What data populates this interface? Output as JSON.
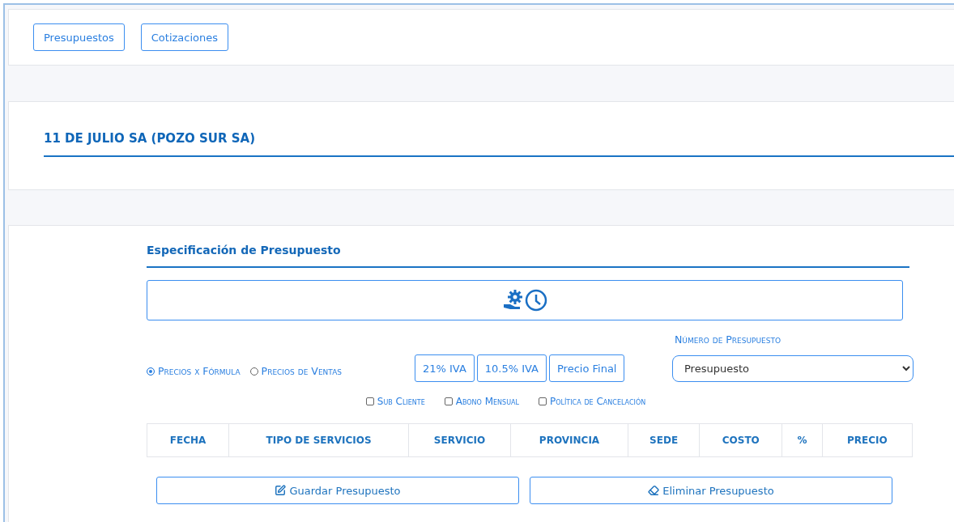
{
  "nav_buttons": [
    {
      "label": "Presupuestos"
    },
    {
      "label": "Cotizaciones"
    }
  ],
  "client_title": "11 DE JULIO SA (POZO SUR SA)",
  "section_title": "Especificación de Presupuesto",
  "price_modes": [
    {
      "label": "Precios x Fórmula",
      "selected": true
    },
    {
      "label": "Precios de Ventas",
      "selected": false
    }
  ],
  "tax_buttons": [
    {
      "label": "21% IVA"
    },
    {
      "label": "10.5% IVA"
    },
    {
      "label": "Precio Final"
    }
  ],
  "budget_number": {
    "label": "Número de Presupuesto",
    "value": "Presupuesto"
  },
  "options": [
    {
      "label": "Sub Cliente",
      "checked": false
    },
    {
      "label": "Abono Mensual",
      "checked": false
    },
    {
      "label": "Política de Cancelación",
      "checked": false
    }
  ],
  "table": {
    "columns": [
      "FECHA",
      "TIPO DE SERVICIOS",
      "SERVICIO",
      "PROVINCIA",
      "SEDE",
      "COSTO",
      "%",
      "PRECIO"
    ]
  },
  "actions": [
    {
      "kind": "save",
      "label": "Guardar Presupuesto"
    },
    {
      "kind": "delete",
      "label": "Eliminar Presupuesto"
    }
  ]
}
